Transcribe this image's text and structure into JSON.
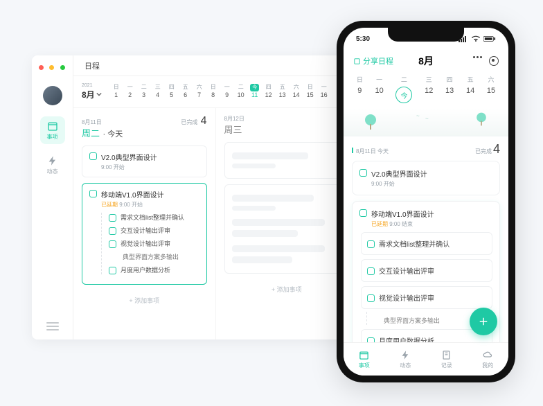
{
  "desktop": {
    "title": "日程",
    "year": "2021",
    "month": "8月",
    "timeline_days": [
      {
        "wk": "日",
        "n": "1"
      },
      {
        "wk": "一",
        "n": "2"
      },
      {
        "wk": "二",
        "n": "3"
      },
      {
        "wk": "三",
        "n": "4"
      },
      {
        "wk": "四",
        "n": "5"
      },
      {
        "wk": "五",
        "n": "6"
      },
      {
        "wk": "六",
        "n": "7"
      },
      {
        "wk": "日",
        "n": "8"
      },
      {
        "wk": "一",
        "n": "9"
      },
      {
        "wk": "二",
        "n": "10"
      },
      {
        "wk": "今",
        "n": "11",
        "today": true
      },
      {
        "wk": "四",
        "n": "12"
      },
      {
        "wk": "五",
        "n": "13"
      },
      {
        "wk": "六",
        "n": "14"
      },
      {
        "wk": "日",
        "n": "15"
      },
      {
        "wk": "一",
        "n": "16"
      }
    ],
    "nav": {
      "items": "事项",
      "activity": "动态"
    },
    "col1": {
      "date": "8月11日",
      "day": "周二",
      "today_label": "今天",
      "done_label": "已完成",
      "done_count": "4",
      "card1": {
        "title": "V2.0典型界面设计",
        "sub": "9:00 开始"
      },
      "card2": {
        "title": "移动端V1.0界面设计",
        "late": "已延期",
        "sub": "9:00 开始",
        "subs": [
          "需求文档list整理并确认",
          "交互设计输出评审",
          "视觉设计输出评审",
          "月度用户数据分析"
        ],
        "sub_sub": "典型界面方案多输出"
      },
      "add": "+ 添加事项"
    },
    "col2": {
      "date": "8月12日",
      "day": "周三",
      "add": "+ 添加事项"
    }
  },
  "phone": {
    "time": "5:30",
    "head_left": "分享日程",
    "month": "8月",
    "days": [
      {
        "wk": "日",
        "n": "9"
      },
      {
        "wk": "一",
        "n": "10"
      },
      {
        "wk": "二",
        "n": "今",
        "today": true
      },
      {
        "wk": "三",
        "n": "12"
      },
      {
        "wk": "四",
        "n": "13"
      },
      {
        "wk": "五",
        "n": "14"
      },
      {
        "wk": "六",
        "n": "15"
      }
    ],
    "list_head": {
      "date": "8月11日 今天",
      "done_label": "已完成",
      "done_count": "4"
    },
    "card1": {
      "title": "V2.0典型界面设计",
      "sub": "9:00 开始"
    },
    "card2": {
      "title": "移动端V1.0界面设计",
      "late": "已延期",
      "sub": "9:00 结束",
      "subs": [
        "需求文档list整理并确认",
        "交互设计输出评审",
        "视觉设计输出评审",
        "月度用户数据分析"
      ],
      "sub_sub": "典型界面方案多输出"
    },
    "tabs": {
      "items": "事项",
      "activity": "动态",
      "record": "记录",
      "mine": "我的"
    }
  }
}
